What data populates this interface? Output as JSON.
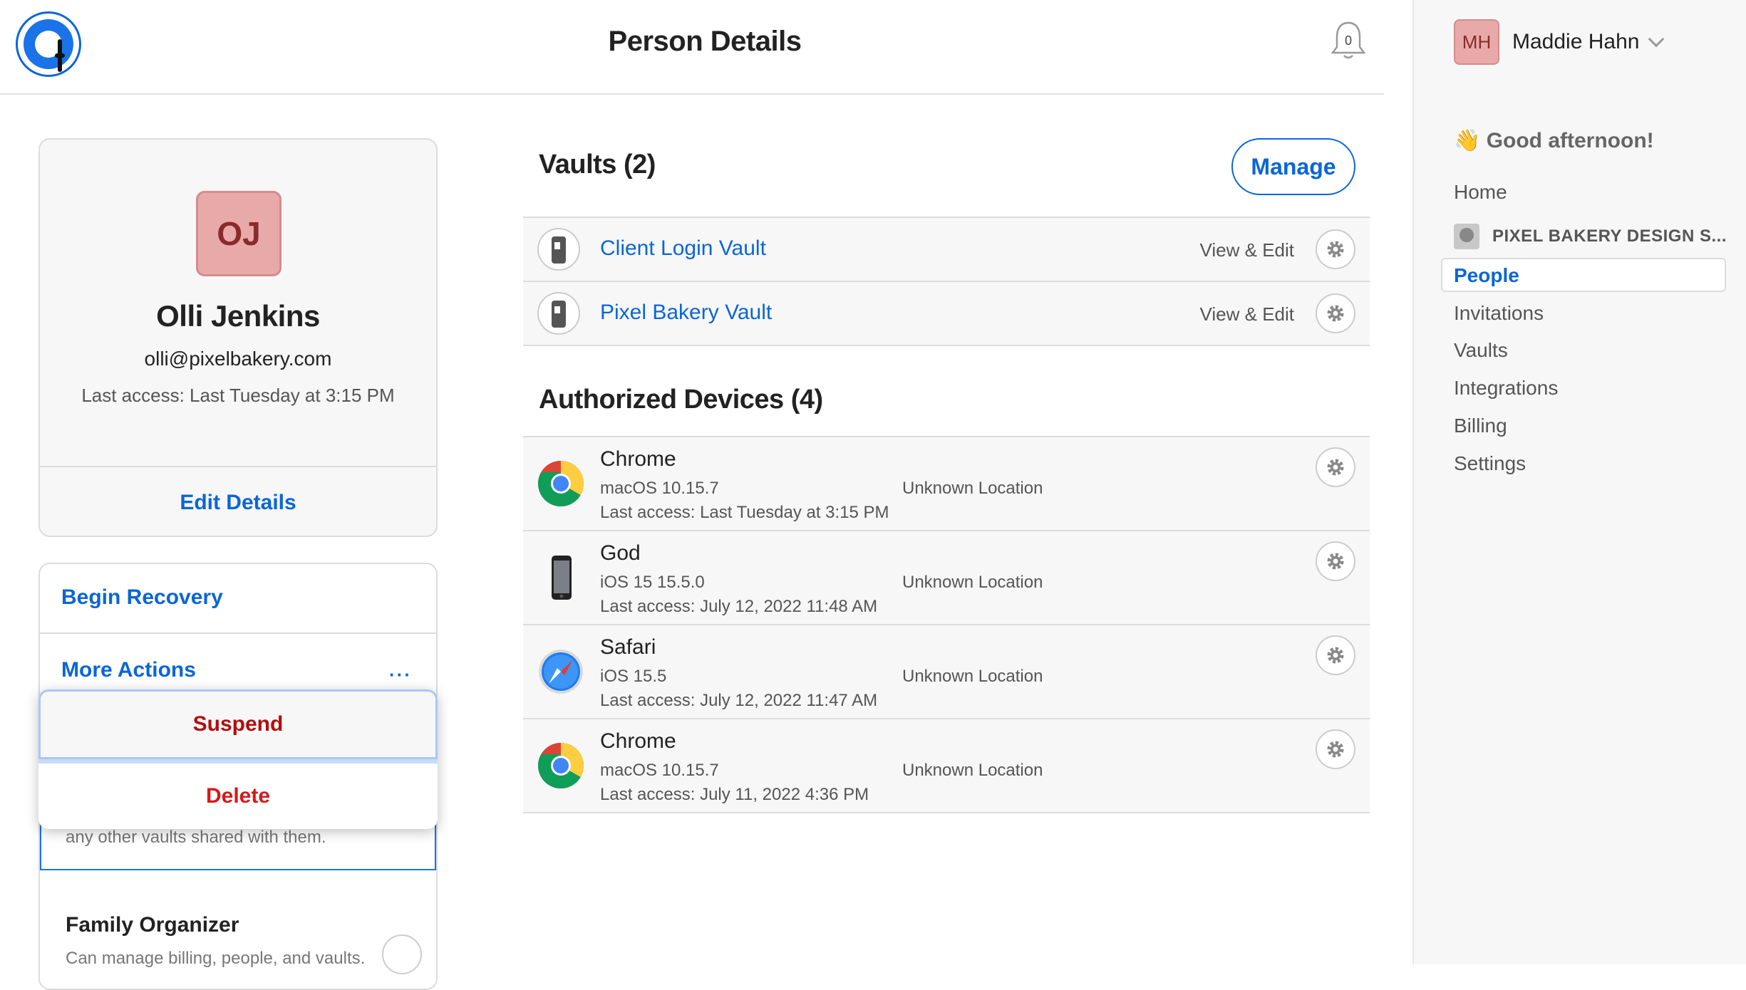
{
  "header": {
    "title": "Person Details",
    "notification_count": "0"
  },
  "sidebar": {
    "user": {
      "initials": "MH",
      "name": "Maddie Hahn"
    },
    "greeting": "👋 Good afternoon!",
    "nav": {
      "home": "Home",
      "org": "PIXEL BAKERY DESIGN S...",
      "people": "People",
      "invitations": "Invitations",
      "vaults": "Vaults",
      "integrations": "Integrations",
      "billing": "Billing",
      "settings": "Settings"
    }
  },
  "person": {
    "initials": "OJ",
    "name": "Olli Jenkins",
    "email": "olli@pixelbakery.com",
    "last_access": "Last access: Last Tuesday at 3:15 PM",
    "edit_label": "Edit Details"
  },
  "actions": {
    "begin_recovery": "Begin Recovery",
    "more_actions": "More Actions",
    "more_dots": "···",
    "partial_text": "any other vaults shared with them.",
    "family_title": "Family Organizer",
    "family_desc": "Can manage billing, people, and vaults."
  },
  "menu": {
    "suspend": "Suspend",
    "delete": "Delete"
  },
  "vaults": {
    "title": "Vaults (2)",
    "manage_label": "Manage",
    "items": [
      {
        "name": "Client Login Vault",
        "permission": "View & Edit"
      },
      {
        "name": "Pixel Bakery Vault",
        "permission": "View & Edit"
      }
    ]
  },
  "devices": {
    "title": "Authorized Devices (4)",
    "items": [
      {
        "name": "Chrome",
        "os": "macOS 10.15.7",
        "location": "Unknown Location",
        "last_access": "Last access: Last Tuesday at 3:15 PM",
        "icon": "chrome-icon"
      },
      {
        "name": "God",
        "os": "iOS 15 15.5.0",
        "location": "Unknown Location",
        "last_access": "Last access: July 12, 2022 11:48 AM",
        "icon": "iphone-icon"
      },
      {
        "name": "Safari",
        "os": "iOS 15.5",
        "location": "Unknown Location",
        "last_access": "Last access: July 12, 2022 11:47 AM",
        "icon": "safari-icon"
      },
      {
        "name": "Chrome",
        "os": "macOS 10.15.7",
        "location": "Unknown Location",
        "last_access": "Last access: July 11, 2022 4:36 PM",
        "icon": "chrome-icon"
      }
    ]
  },
  "colors": {
    "accent": "#0a66d6",
    "danger": "#d61a1a",
    "avatar_bg": "#e8a9a9"
  }
}
